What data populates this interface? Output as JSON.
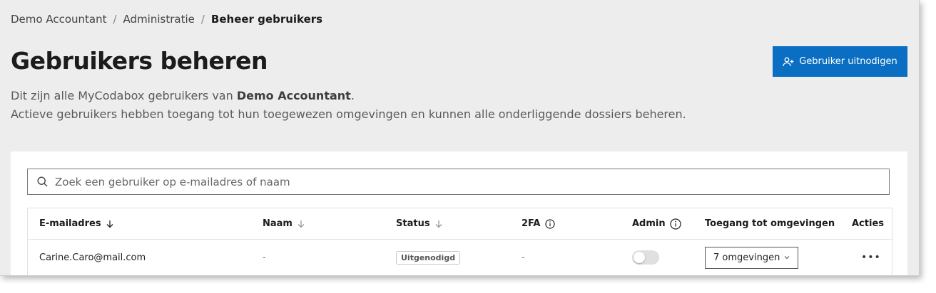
{
  "breadcrumb": {
    "items": [
      "Demo Accountant",
      "Administratie"
    ],
    "current": "Beheer gebruikers"
  },
  "page": {
    "title": "Gebruikers beheren",
    "desc_line1_prefix": "Dit zijn alle MyCodabox gebruikers van ",
    "desc_line1_bold": "Demo Accountant",
    "desc_line1_suffix": ".",
    "desc_line2": "Actieve gebruikers hebben toegang tot hun toegewezen omgevingen en kunnen alle onderliggende dossiers beheren."
  },
  "invite_button": {
    "label": "Gebruiker uitnodigen",
    "icon": "user-plus-icon",
    "color": "#0a6fc2"
  },
  "search": {
    "placeholder": "Zoek een gebruiker op e-mailadres of naam",
    "value": ""
  },
  "table": {
    "headers": {
      "email": "E-mailadres",
      "name": "Naam",
      "status": "Status",
      "twofa": "2FA",
      "admin": "Admin",
      "access": "Toegang tot omgevingen",
      "actions": "Acties"
    },
    "rows": [
      {
        "email": "Carine.Caro@mail.com",
        "name": "-",
        "status": "Uitgenodigd",
        "twofa": "-",
        "admin": false,
        "access": "7 omgevingen"
      }
    ]
  }
}
